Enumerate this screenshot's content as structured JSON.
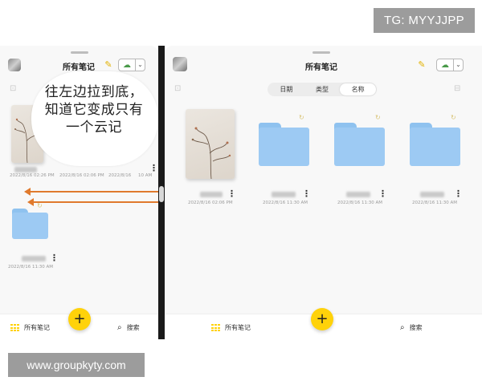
{
  "watermarks": {
    "top": "TG: MYYJJPP",
    "bottom": "www.groupkyty.com"
  },
  "colors": {
    "accent": "#ffd20a",
    "folder": "#9dcaf3",
    "arrow": "#e07a2d"
  },
  "left_pane": {
    "title": "所有笔记",
    "tooltip": "往左边拉到底，知道它变成只有一个云记",
    "notes": [
      {
        "type": "notebook",
        "date": "2022/8/16 02:26 PM"
      },
      {
        "type": "notebook",
        "date": "2022/8/16 02:06 PM"
      },
      {
        "type": "notebook",
        "date": "2022/8/16"
      },
      {
        "type": "notebook",
        "date": "10 AM"
      },
      {
        "type": "folder",
        "date": "2022/8/16 11:30 AM"
      }
    ],
    "nav": {
      "home_label": "所有笔记",
      "search_label": "搜索",
      "fab_label": "+"
    }
  },
  "right_pane": {
    "title": "所有笔记",
    "sort_tabs": [
      {
        "label": "日期",
        "active": false
      },
      {
        "label": "类型",
        "active": false
      },
      {
        "label": "名称",
        "active": true
      }
    ],
    "items": [
      {
        "type": "notebook",
        "date": "2022/8/16 02:06 PM"
      },
      {
        "type": "folder",
        "date": "2022/8/16 11:30 AM"
      },
      {
        "type": "folder",
        "date": "2022/8/16 11:30 AM"
      },
      {
        "type": "folder",
        "date": "2022/8/16 11:30 AM"
      }
    ],
    "nav": {
      "home_label": "所有笔记",
      "search_label": "搜索",
      "fab_label": "+"
    }
  },
  "icons": {
    "dots": "⋮",
    "edit": "✎",
    "cloud": "☁",
    "chevron": "⌄",
    "sync": "↻",
    "search": "🔍"
  }
}
